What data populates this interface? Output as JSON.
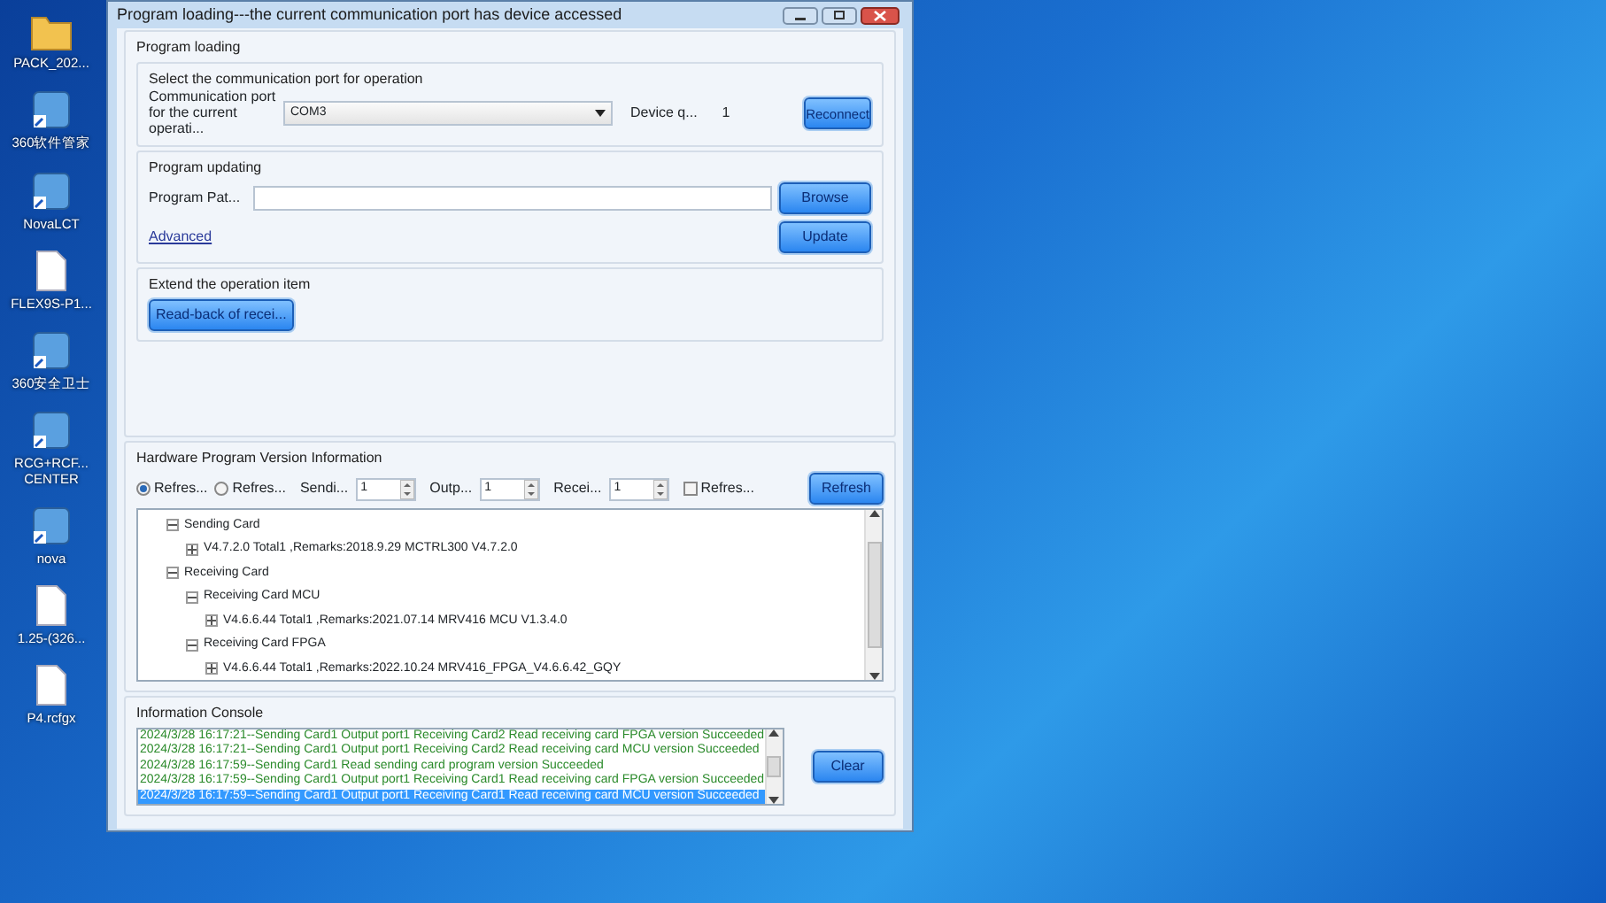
{
  "desktop_icons": [
    {
      "label": "PACK_202...",
      "kind": "folder"
    },
    {
      "label": "360软件管家",
      "kind": "app"
    },
    {
      "label": "NovaLCT",
      "kind": "app"
    },
    {
      "label": "FLEX9S-P1...",
      "kind": "file"
    },
    {
      "label": "360安全卫士",
      "kind": "app"
    },
    {
      "label": "RCG+RCF... CENTER",
      "kind": "app"
    },
    {
      "label": "nova",
      "kind": "app"
    },
    {
      "label": "1.25-(326...",
      "kind": "file"
    },
    {
      "label": "P4.rcfgx",
      "kind": "file"
    }
  ],
  "window": {
    "title": "Program loading---the current communication port has device accessed"
  },
  "program_loading": {
    "title": "Program loading",
    "port": {
      "title": "Select the communication port for operation",
      "label": "Communication port for the current operati...",
      "value": "COM3",
      "device_label": "Device q...",
      "device_count": "1",
      "button": "Reconnect"
    },
    "updating": {
      "title": "Program updating",
      "path_label": "Program Pat...",
      "browse": "Browse",
      "advanced": "Advanced",
      "update": "Update"
    },
    "extend": {
      "title": "Extend the operation item",
      "button": "Read-back of recei..."
    }
  },
  "hardware": {
    "title": "Hardware Program Version Information",
    "radios": [
      {
        "label": "Refres...",
        "selected": true
      },
      {
        "label": "Refres...",
        "selected": false
      }
    ],
    "spinners": [
      {
        "label": "Sendi...",
        "value": "1"
      },
      {
        "label": "Outp...",
        "value": "1"
      },
      {
        "label": "Recei...",
        "value": "1"
      }
    ],
    "checkbox": {
      "label": "Refres...",
      "checked": false
    },
    "refresh": "Refresh",
    "tree": [
      {
        "label": "Sending Card",
        "expanded": true,
        "children": [
          {
            "label": "V4.7.2.0 Total1 ,Remarks:2018.9.29 MCTRL300 V4.7.2.0",
            "expanded": false
          }
        ]
      },
      {
        "label": "Receiving Card",
        "expanded": true,
        "children": [
          {
            "label": "Receiving Card MCU",
            "expanded": true,
            "children": [
              {
                "label": "V4.6.6.44 Total1 ,Remarks:2021.07.14 MRV416 MCU V1.3.4.0",
                "expanded": false
              }
            ]
          },
          {
            "label": "Receiving Card FPGA",
            "expanded": true,
            "children": [
              {
                "label": "V4.6.6.44 Total1 ,Remarks:2022.10.24 MRV416_FPGA_V4.6.6.42_GQY",
                "expanded": false
              }
            ]
          }
        ]
      }
    ]
  },
  "console": {
    "title": "Information Console",
    "lines": [
      {
        "text": "2024/3/28 16:17:21--Sending Card1 Output port1 Receiving Card2 Read receiving card FPGA version Succeeded",
        "selected": false
      },
      {
        "text": "2024/3/28 16:17:21--Sending Card1 Output port1 Receiving Card2 Read receiving card MCU version Succeeded",
        "selected": false
      },
      {
        "text": "2024/3/28 16:17:59--Sending Card1 Read sending card program version Succeeded",
        "selected": false
      },
      {
        "text": "2024/3/28 16:17:59--Sending Card1 Output port1 Receiving Card1 Read receiving card FPGA version Succeeded",
        "selected": false
      },
      {
        "text": "2024/3/28 16:17:59--Sending Card1 Output port1 Receiving Card1 Read receiving card MCU version Succeeded",
        "selected": true
      }
    ],
    "clear": "Clear"
  }
}
